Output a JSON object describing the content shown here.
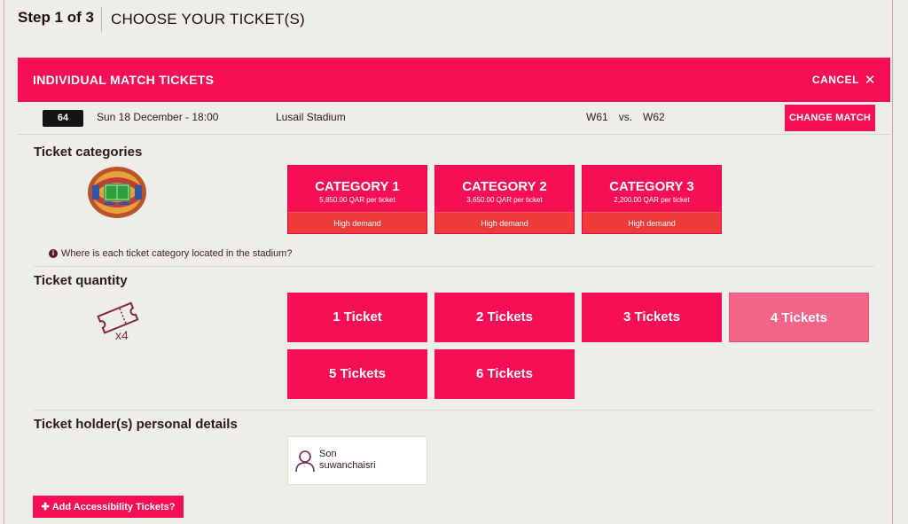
{
  "step": {
    "number": "Step 1 of 3",
    "title": "CHOOSE YOUR TICKET(S)"
  },
  "panel": {
    "title": "INDIVIDUAL MATCH TICKETS",
    "cancel_label": "CANCEL",
    "cancel_icon": "close-icon"
  },
  "match": {
    "number": "64",
    "date": "Sun 18 December - 18:00",
    "venue": "Lusail Stadium",
    "team_home": "W61",
    "versus": "vs.",
    "team_away": "W62",
    "change_label": "CHANGE MATCH"
  },
  "categories": {
    "title": "Ticket categories",
    "items": [
      {
        "name": "CATEGORY 1",
        "price": "5,850.00 QAR per ticket",
        "demand": "High demand"
      },
      {
        "name": "CATEGORY 2",
        "price": "3,650.00 QAR per ticket",
        "demand": "High demand"
      },
      {
        "name": "CATEGORY 3",
        "price": "2,200.00 QAR per ticket",
        "demand": "High demand"
      }
    ],
    "info_link": "Where is each ticket category located in the stadium?"
  },
  "quantity": {
    "title": "Ticket quantity",
    "icon_label": "x4",
    "options": [
      "1 Ticket",
      "2 Tickets",
      "3 Tickets",
      "4 Tickets",
      "5 Tickets",
      "6 Tickets"
    ],
    "selected": "4 Tickets"
  },
  "holders": {
    "title": "Ticket holder(s) personal details",
    "items": [
      {
        "first": "Son",
        "last": "suwanchaisri"
      }
    ]
  },
  "accessibility": {
    "label": "Add Accessibility Tickets?",
    "icon": "plus-icon"
  },
  "colors": {
    "accent": "#f70f55",
    "selected": "#f46487",
    "demand": "#ef3a3a",
    "background": "#efede8"
  }
}
